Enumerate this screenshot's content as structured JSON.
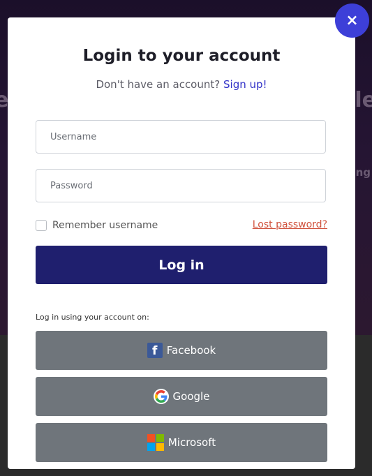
{
  "background": {
    "left_text": "e",
    "right_text": "le",
    "right_text2": "ng"
  },
  "modal": {
    "title": "Login to your account",
    "no_account_text": "Don't have an account?",
    "signup_label": "Sign up!",
    "username_placeholder": "Username",
    "password_placeholder": "Password",
    "remember_label": "Remember username",
    "lost_password_label": "Lost password?",
    "login_button_label": "Log in",
    "social_caption": "Log in using your account on:",
    "social": [
      {
        "label": "Facebook",
        "icon": "facebook-icon"
      },
      {
        "label": "Google",
        "icon": "google-icon"
      },
      {
        "label": "Microsoft",
        "icon": "microsoft-icon"
      }
    ],
    "close_icon": "×"
  },
  "colors": {
    "accent": "#3d3fd8",
    "primary_button": "#1f1f6e",
    "social_button": "#6f757b",
    "link": "#3232c8",
    "lost_link": "#d0513c"
  }
}
